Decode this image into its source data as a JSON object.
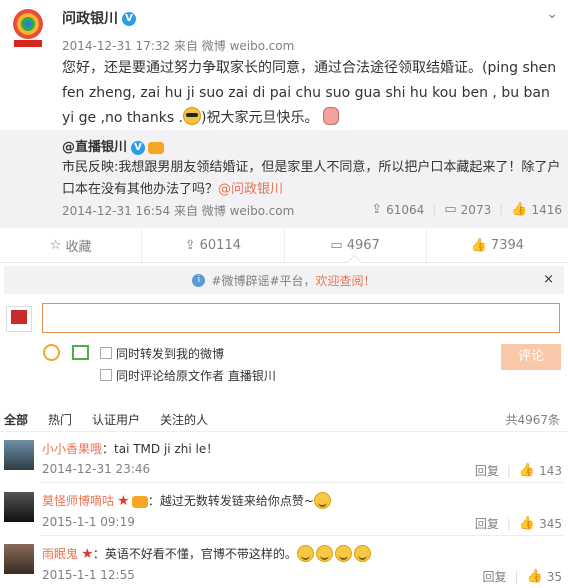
{
  "post": {
    "author": "问政银川",
    "verified_icon": "V",
    "meta": "2014-12-31 17:32 来自 微博 weibo.com",
    "text_part1": "您好，还是要通过努力争取家长的同意，通过合法途径领取结婚证。(ping shen fen zheng, zai hu ji suo zai di pai chu suo gua shi hu kou ben , bu ban yi ge ,no thanks .",
    "text_part2": ")祝大家元旦快乐。",
    "menu_icon": "⌄"
  },
  "repost": {
    "author": "@直播银川",
    "text_part1": "市民反映:我想跟男朋友领结婚证，但是家里人不同意，所以把户口本藏起来了！除了户口本在没有其他办法了吗？",
    "mention": "@问政银川",
    "meta": "2014-12-31 16:54 来自 微博 weibo.com",
    "forward_count": "61064",
    "comment_count": "2073",
    "like_count": "1416"
  },
  "actions": {
    "favorite": "收藏",
    "forward": "60114",
    "comment": "4967",
    "like": "7394"
  },
  "notice": {
    "text_prefix": "#微博辟谣#平台，",
    "text_link": "欢迎查阅！",
    "close": "×"
  },
  "composer": {
    "placeholder": "",
    "option1": "同时转发到我的微博",
    "option2": "同时评论给原文作者 直播银川",
    "submit": "评论"
  },
  "tabs": {
    "items": [
      "全部",
      "热门",
      "认证用户",
      "关注的人"
    ],
    "total": "共4967条"
  },
  "comments": [
    {
      "name": "小小香果哦",
      "text": "：tai TMD ji zhi le！",
      "time": "2014-12-31 23:46",
      "reply": "回复",
      "likes": "143"
    },
    {
      "name": "莫怪师博嘀咕",
      "text": "：越过无数转发链来给你点赞~",
      "time": "2015-1-1 09:19",
      "reply": "回复",
      "likes": "345"
    },
    {
      "name": "雨眠鬼",
      "text": "：英语不好看不懂，官博不带这样的。",
      "time": "2015-1-1 12:55",
      "reply": "回复",
      "likes": "35"
    }
  ],
  "colors": {
    "accent": "#eb7350",
    "link_blue": "#2b9fe6",
    "bg_gray": "#f2f2f5"
  }
}
